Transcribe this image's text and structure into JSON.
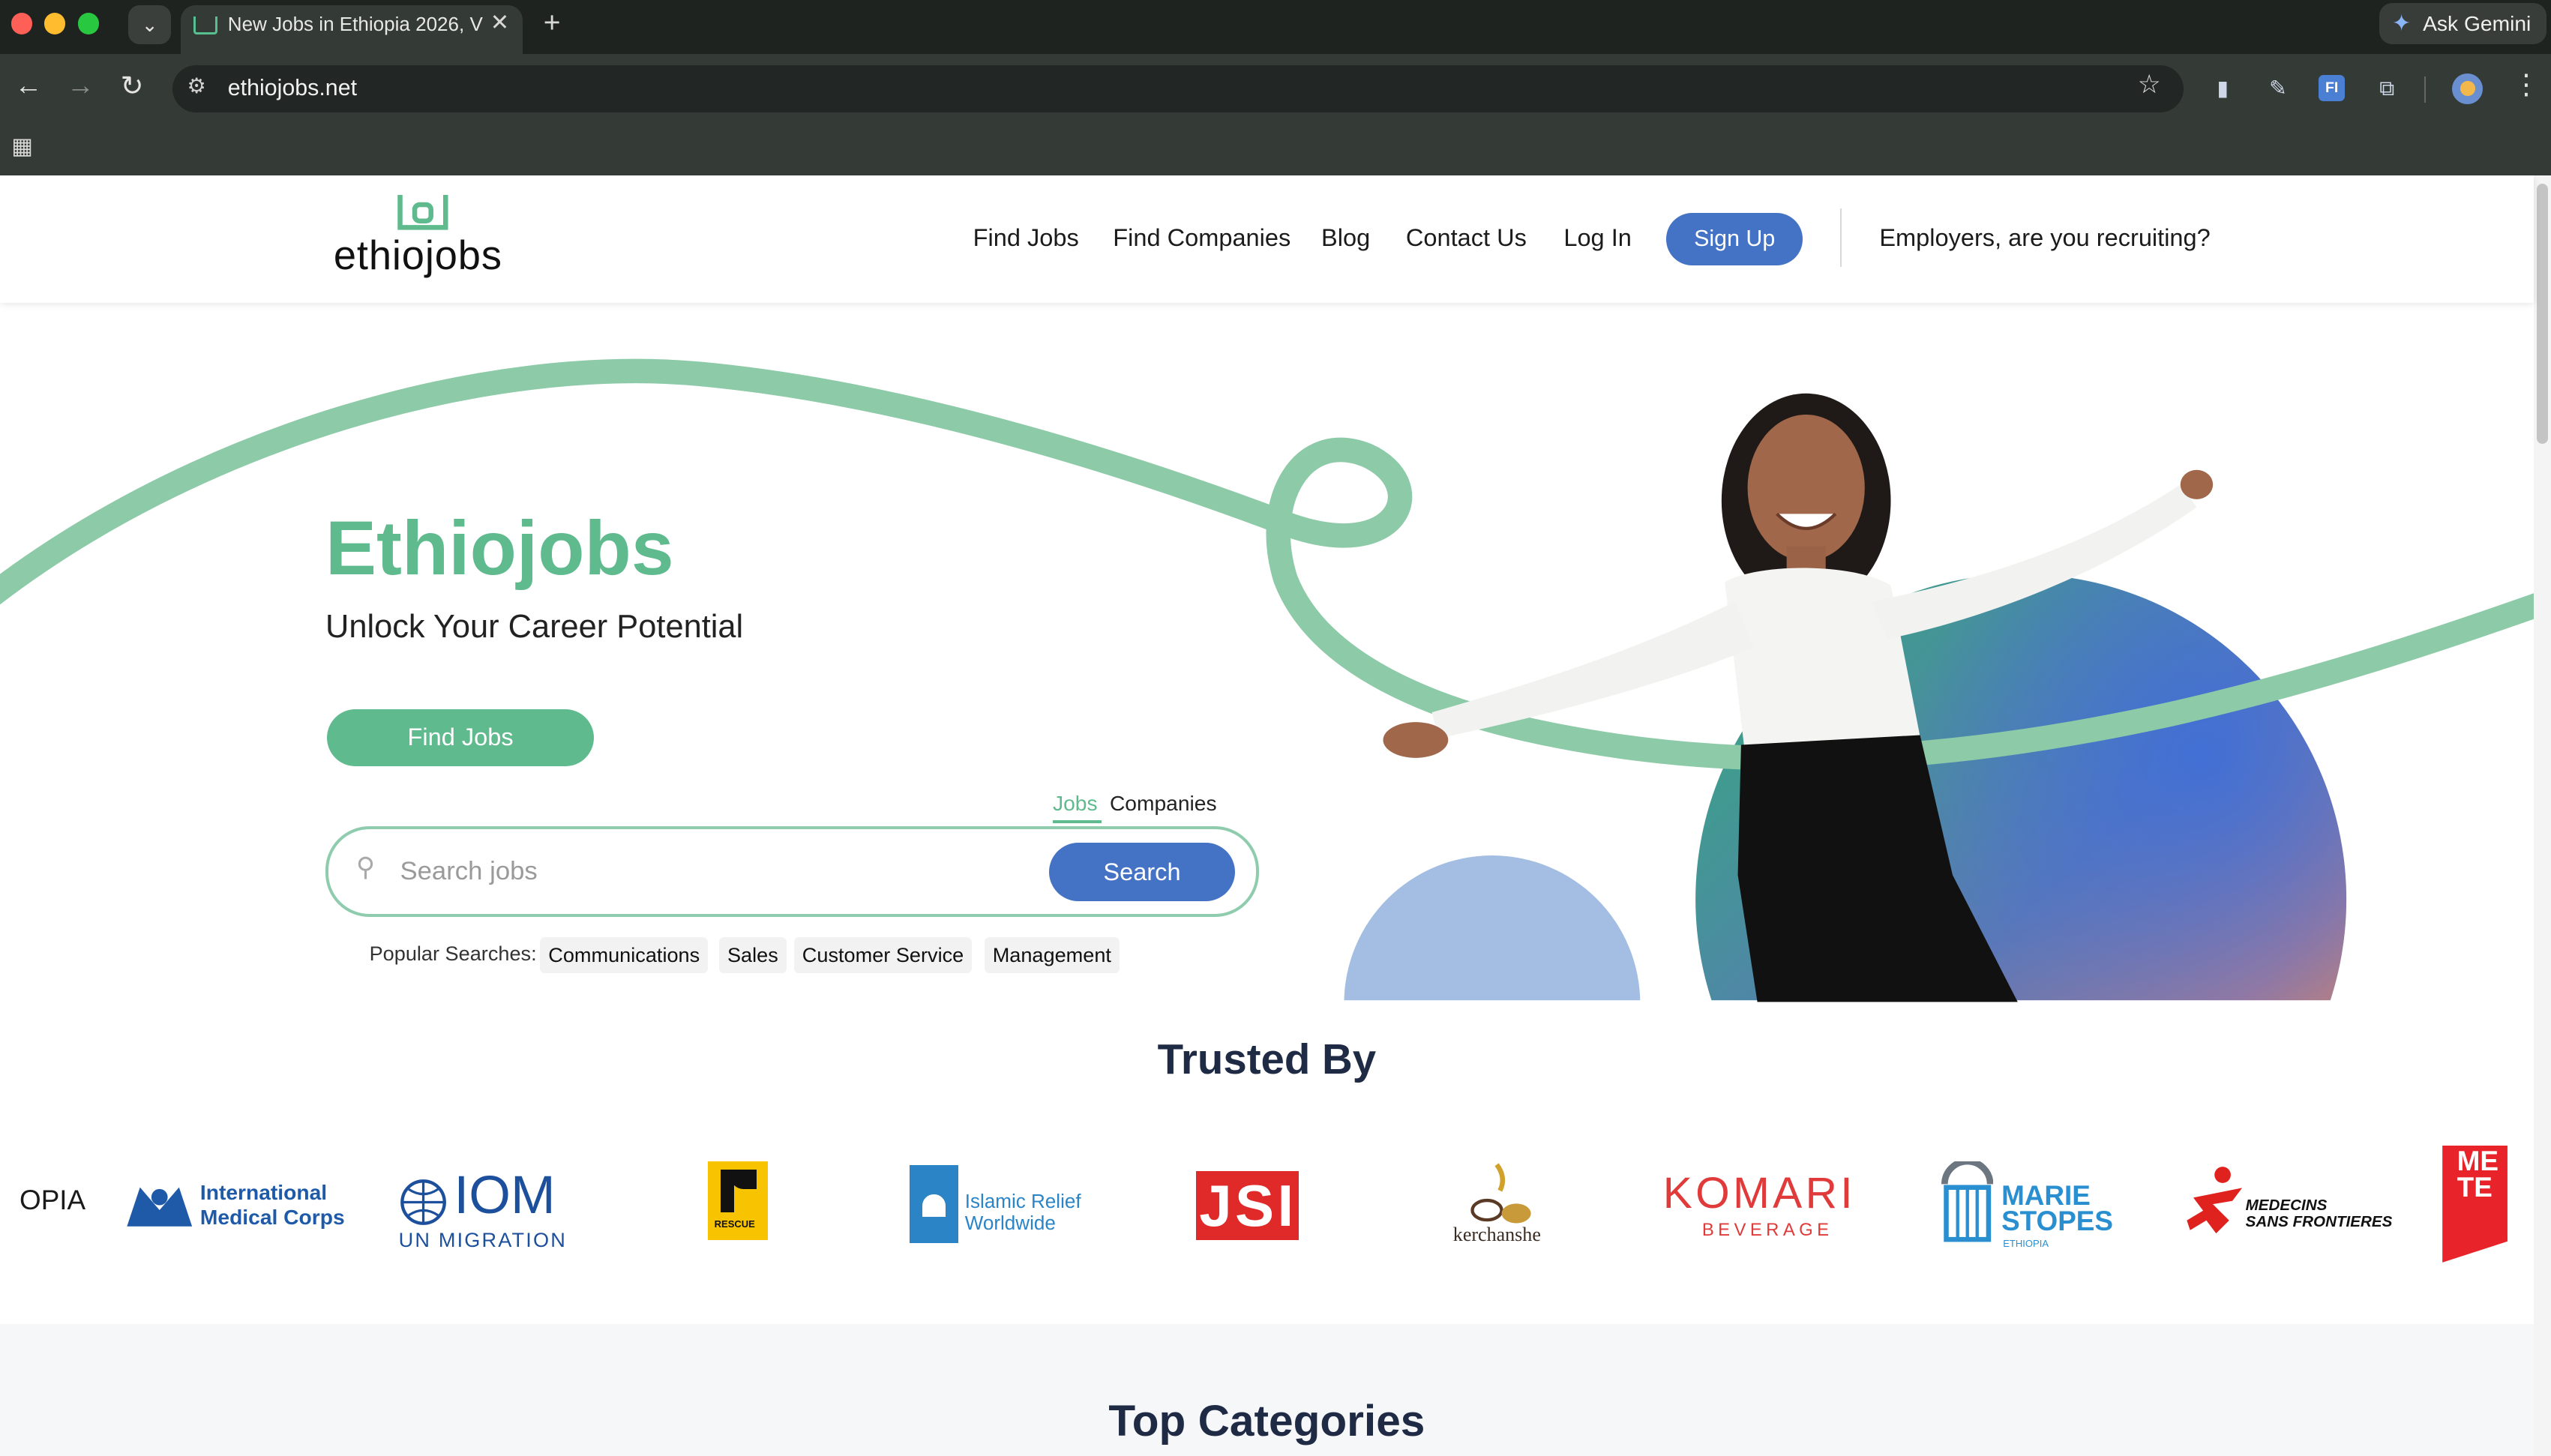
{
  "browser": {
    "tab_title": "New Jobs in Ethiopia 2026, V",
    "url": "ethiojobs.net",
    "ask_gemini": "Ask Gemini",
    "extension_badge": "FI"
  },
  "site": {
    "logo_text": "ethiojobs",
    "nav": {
      "find_jobs": "Find Jobs",
      "find_companies": "Find Companies",
      "blog": "Blog",
      "contact": "Contact Us",
      "login": "Log In",
      "signup": "Sign Up",
      "employers": "Employers, are you recruiting?"
    }
  },
  "hero": {
    "title": "Ethiojobs",
    "subtitle": "Unlock Your Career Potential",
    "cta": "Find Jobs",
    "search_tabs": [
      "Jobs",
      "Companies"
    ],
    "search_placeholder": "Search jobs",
    "search_button": "Search",
    "popular_label": "Popular Searches:",
    "popular": [
      "Communications",
      "Sales",
      "Customer Service",
      "Management"
    ]
  },
  "trusted": {
    "title": "Trusted By",
    "logos": {
      "partial_left": "OPIA",
      "imc_line1": "International",
      "imc_line2": "Medical Corps",
      "iom_big": "IOM",
      "iom_small": "UN MIGRATION",
      "irc": "RESCUE",
      "ir_line1": "Islamic Relief",
      "ir_line2": "Worldwide",
      "jsi": "JSI",
      "kerchanshe": "kerchanshe",
      "komari": "KOMARI",
      "komari_sub": "BEVERAGE",
      "ms_line1": "MARIE",
      "ms_line2": "STOPES",
      "ms_sub": "ETHIOPIA",
      "msf_line1": "MEDECINS",
      "msf_line2": "SANS FRONTIERES",
      "partial_right": "ME TE"
    }
  },
  "categories": {
    "title": "Top Categories"
  },
  "colors": {
    "brand_green": "#5fba8e",
    "brand_blue": "#4473c5",
    "heading_navy": "#1f2b45"
  }
}
